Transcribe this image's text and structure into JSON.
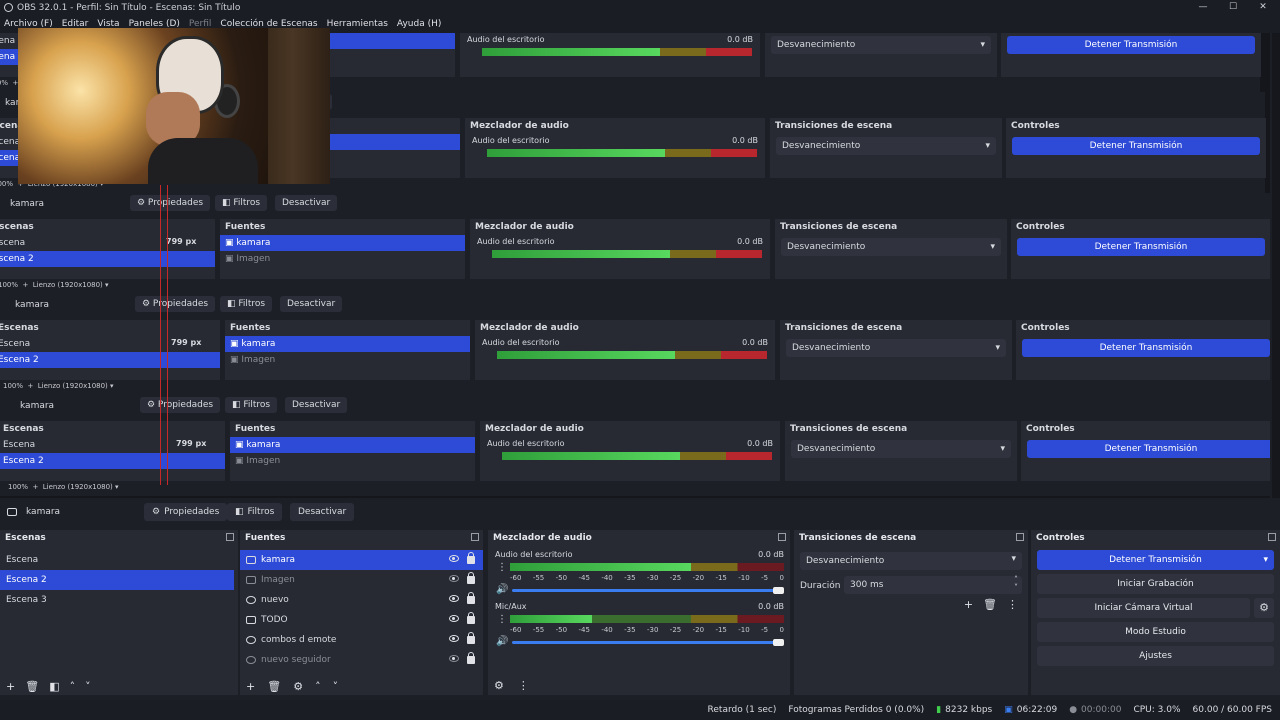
{
  "window": {
    "title": "OBS 32.0.1 - Perfil: Sin Título - Escenas: Sin Título",
    "min": "—",
    "max": "☐",
    "close": "✕"
  },
  "menu": [
    "Archivo (F)",
    "Editar",
    "Vista",
    "Paneles (D)",
    "Perfil",
    "Colección de Escenas",
    "Herramientas",
    "Ayuda (H)"
  ],
  "source_bar": {
    "selected": "kamara",
    "properties": "Propiedades",
    "filters": "Filtros",
    "deactivate": "Desactivar"
  },
  "scenes": {
    "title": "Escenas",
    "items": [
      "Escena",
      "Escena 2",
      "Escena 3"
    ],
    "selected": 1
  },
  "sources": {
    "title": "Fuentes",
    "items": [
      {
        "name": "kamara",
        "visible": true,
        "selected": true
      },
      {
        "name": "Imagen",
        "visible": false
      },
      {
        "name": "nuevo",
        "visible": true
      },
      {
        "name": "TODO",
        "visible": true
      },
      {
        "name": "combos d emote",
        "visible": true
      },
      {
        "name": "nuevo seguidor",
        "visible": false
      }
    ]
  },
  "mixer": {
    "title": "Mezclador de audio",
    "channels": [
      {
        "name": "Audio del escritorio",
        "db": "0.0 dB",
        "level": 0.66
      },
      {
        "name": "Mic/Aux",
        "db": "0.0 dB",
        "level": 0.3
      }
    ],
    "scale": [
      "-60",
      "-55",
      "-50",
      "-45",
      "-40",
      "-35",
      "-30",
      "-25",
      "-20",
      "-15",
      "-10",
      "-5",
      "0"
    ]
  },
  "transitions": {
    "title": "Transiciones de escena",
    "selected": "Desvanecimiento",
    "duration_label": "Duración",
    "duration": "300 ms"
  },
  "controls": {
    "title": "Controles",
    "buttons": [
      "Detener Transmisión",
      "Iniciar Grabación",
      "Iniciar Cámara Virtual",
      "Modo Estudio",
      "Ajustes"
    ]
  },
  "echo": {
    "zoom": "100%",
    "canvas": "Lienzo (1920x1080)",
    "px_label": "799 px"
  },
  "status": {
    "delay": "Retardo (1 sec)",
    "dropped": "Fotogramas Perdidos 0 (0.0%)",
    "bitrate": "8232 kbps",
    "stream_time": "06:22:09",
    "rec_time": "00:00:00",
    "cpu": "CPU: 3.0%",
    "fps": "60.00 / 60.00 FPS"
  }
}
